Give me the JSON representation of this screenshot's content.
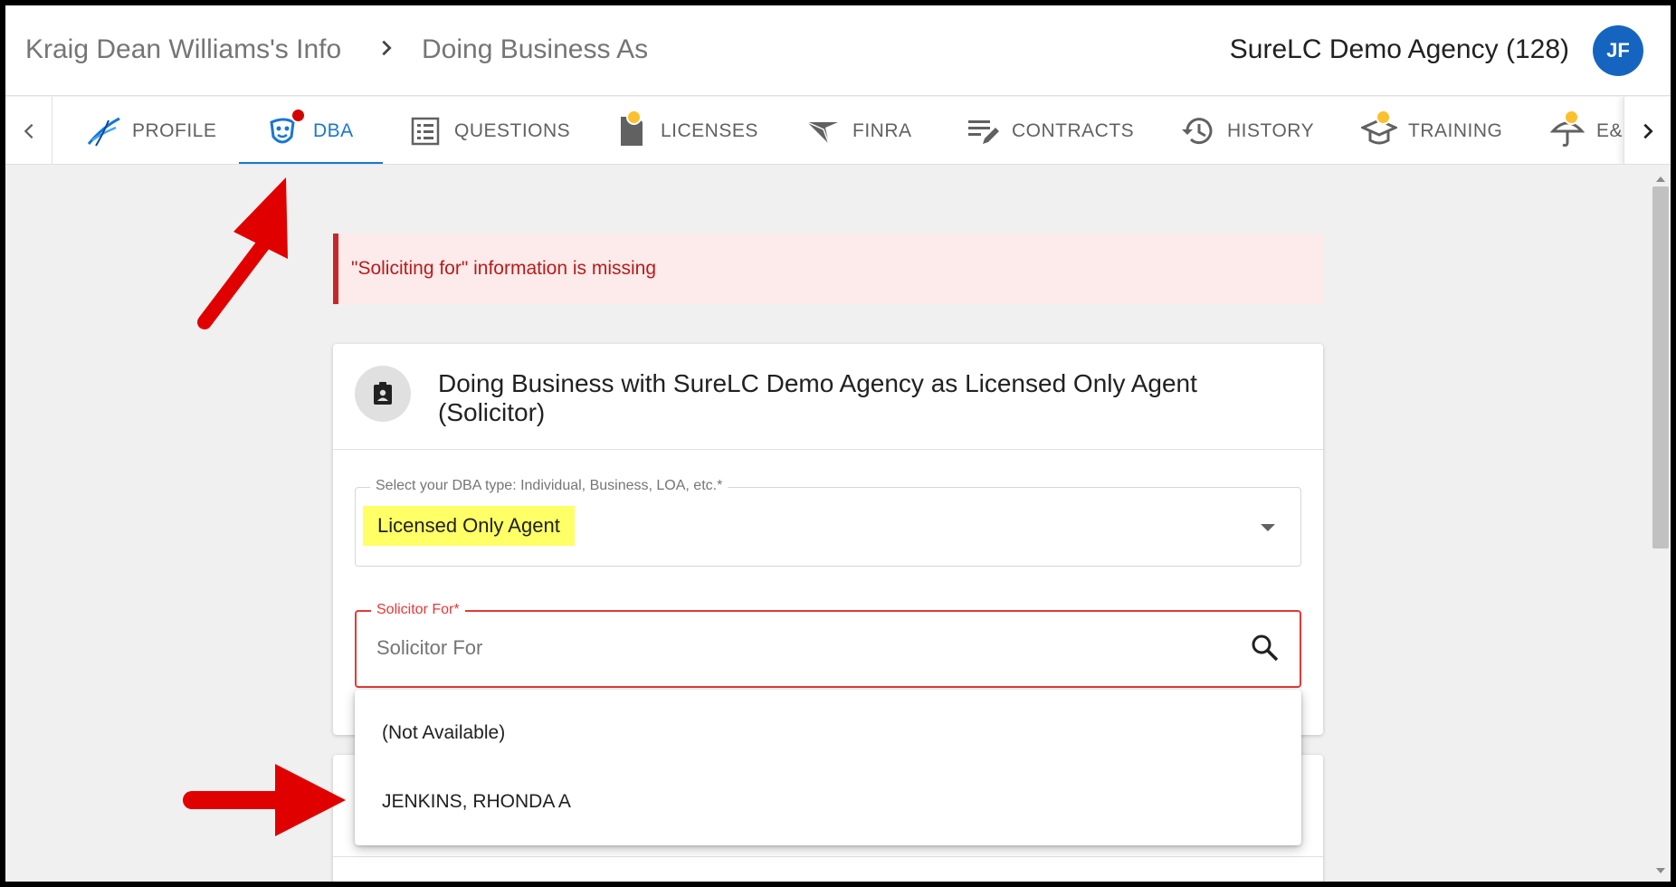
{
  "header": {
    "breadcrumb_parent": "Kraig Dean Williams's Info",
    "breadcrumb_current": "Doing Business As",
    "agency": "SureLC Demo Agency (128)",
    "avatar_initials": "JF"
  },
  "tabs": [
    {
      "label": "PROFILE",
      "icon": "profile-swoosh-icon",
      "badge": null
    },
    {
      "label": "DBA",
      "icon": "masks-icon",
      "badge": "#d50000",
      "active": true
    },
    {
      "label": "QUESTIONS",
      "icon": "list-icon",
      "badge": null
    },
    {
      "label": "LICENSES",
      "icon": "document-icon",
      "badge": "#fbc02d"
    },
    {
      "label": "FINRA",
      "icon": "finra-icon",
      "badge": null
    },
    {
      "label": "CONTRACTS",
      "icon": "edit-lines-icon",
      "badge": null
    },
    {
      "label": "HISTORY",
      "icon": "history-icon",
      "badge": null
    },
    {
      "label": "TRAINING",
      "icon": "graduation-cap-icon",
      "badge": "#fbc02d"
    },
    {
      "label": "E&O",
      "icon": "umbrella-icon",
      "badge": "#fbc02d"
    }
  ],
  "alert": {
    "message": "\"Soliciting for\" information is missing"
  },
  "card": {
    "title": "Doing Business with SureLC Demo Agency as Licensed Only Agent (Solicitor)",
    "dba_type_label": "Select your DBA type: Individual, Business, LOA, etc.*",
    "dba_type_value": "Licensed Only Agent",
    "solicitor_label": "Solicitor For*",
    "solicitor_placeholder": "Solicitor For"
  },
  "menu": {
    "items": [
      "(Not Available)",
      "JENKINS, RHONDA A"
    ]
  },
  "colors": {
    "accent": "#1976d2",
    "error": "#e53935",
    "highlight": "#ffff66",
    "annotation_arrow": "#e00000"
  }
}
